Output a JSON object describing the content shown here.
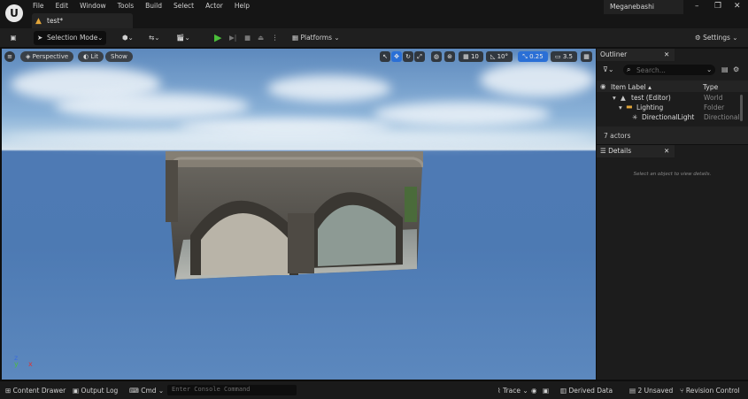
{
  "menu": {
    "items": [
      "File",
      "Edit",
      "Window",
      "Tools",
      "Build",
      "Select",
      "Actor",
      "Help"
    ]
  },
  "document_tab": {
    "label": "test*"
  },
  "project_name": "Meganebashi",
  "window_controls": {
    "minimize": "–",
    "maximize": "❐",
    "close": "✕"
  },
  "toolbar": {
    "selection_mode": "Selection Mode",
    "platforms": "Platforms",
    "settings": "Settings"
  },
  "viewport": {
    "perspective": "Perspective",
    "lit": "Lit",
    "show": "Show",
    "grid_snap": "10",
    "rotation_snap": "10°",
    "scale_snap": "0.25",
    "camera_speed": "3.5"
  },
  "outliner": {
    "title": "Outliner",
    "search_placeholder": "Search...",
    "col_label": "Item Label ▴",
    "col_type": "Type",
    "rows": [
      {
        "label": "test (Editor)",
        "type": "World"
      },
      {
        "label": "Lighting",
        "type": "Folder"
      },
      {
        "label": "DirectionalLight",
        "type": "Directional"
      }
    ],
    "actor_count": "7 actors"
  },
  "details": {
    "title": "Details",
    "empty_message": "Select an object to view details."
  },
  "bottombar": {
    "content_drawer": "Content Drawer",
    "output_log": "Output Log",
    "cmd": "Cmd",
    "console_placeholder": "Enter Console Command",
    "trace": "Trace",
    "derived_data": "Derived Data",
    "unsaved": "2 Unsaved",
    "revision_control": "Revision Control"
  },
  "colors": {
    "accent_blue": "#2a6fd6",
    "play_green": "#4bbf3a",
    "folder_orange": "#e2a53a"
  }
}
